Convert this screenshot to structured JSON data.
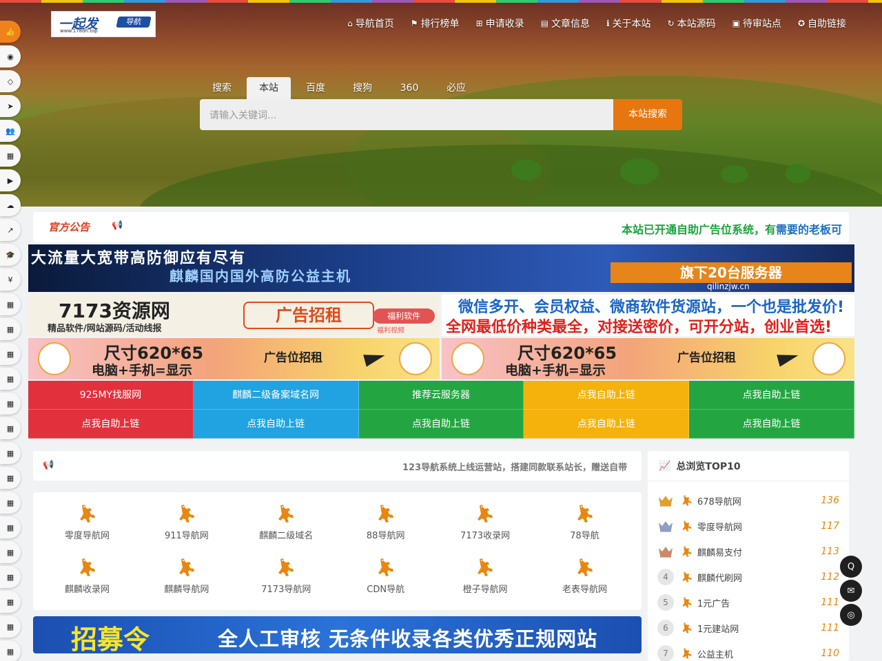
{
  "logo": {
    "brand": "一起发",
    "tag": "导航",
    "domain": "www.178dh.top"
  },
  "nav": [
    {
      "icon": "home-icon",
      "glyph": "⌂",
      "label": "导航首页"
    },
    {
      "icon": "flag-icon",
      "glyph": "⚑",
      "label": "排行榜单"
    },
    {
      "icon": "plus-square-icon",
      "glyph": "⊞",
      "label": "申请收录"
    },
    {
      "icon": "book-icon",
      "glyph": "▤",
      "label": "文章信息"
    },
    {
      "icon": "info-icon",
      "glyph": "ℹ",
      "label": "关于本站"
    },
    {
      "icon": "refresh-icon",
      "glyph": "↻",
      "label": "本站源码"
    },
    {
      "icon": "file-icon",
      "glyph": "▣",
      "label": "待审站点"
    },
    {
      "icon": "handshake-icon",
      "glyph": "✪",
      "label": "自助链接"
    }
  ],
  "search": {
    "tabs": [
      "搜索",
      "本站",
      "百度",
      "搜狗",
      "360",
      "必应"
    ],
    "active_tab": "本站",
    "placeholder": "请输入关键词...",
    "button": "本站搜索"
  },
  "sidebar_icons": [
    "thumbs-up-icon",
    "eye-icon",
    "diamond-icon",
    "paper-plane-icon",
    "users-icon",
    "cubes-icon",
    "youtube-icon",
    "cloud-icon",
    "line-chart-icon",
    "graduation-cap-icon",
    "yen-icon",
    "th-large-icon",
    "cubes-icon",
    "cubes-icon",
    "cubes-icon",
    "cubes-icon",
    "cubes-icon",
    "cubes-icon",
    "cubes-icon",
    "cubes-icon",
    "cubes-icon",
    "cubes-icon",
    "cubes-icon",
    "cubes-icon",
    "cubes-icon",
    "cubes-icon"
  ],
  "announcement": {
    "label": "官方公告",
    "message_a": "本站已开通自助广告位系统，有",
    "message_b": "需要的老板可"
  },
  "banners": {
    "qilin": {
      "line1": "大流量大宽带高防御应有尽有",
      "line2": "麒麟国内国外高防公益主机",
      "badge": "旗下20台服务器",
      "domain": "qilinzjw.cn"
    },
    "res7173": {
      "title": "7173资源网",
      "subtitle": "精品软件/网站源码/活动线报",
      "ad": "广告招租",
      "pill": "福利软件",
      "pill_sub": "福利视频"
    },
    "wechat": {
      "line1": "微信多开、会员权益、微商软件货源站，一个也是批发价!",
      "line2": "全网最低价种类最全，对接送密价，可开分站，创业首选!"
    },
    "size_ad": {
      "size": "尺寸620*65",
      "devices": "电脑+手机=显示",
      "ad": "广告位招租"
    }
  },
  "link_grid": [
    {
      "label": "925MY找服网",
      "color": "red"
    },
    {
      "label": "麒麟二级备案域名网",
      "color": "blue"
    },
    {
      "label": "推荐云服务器",
      "color": "green"
    },
    {
      "label": "点我自助上链",
      "color": "yellow"
    },
    {
      "label": "点我自助上链",
      "color": "green"
    },
    {
      "label": "点我自助上链",
      "color": "red"
    },
    {
      "label": "点我自助上链",
      "color": "blue"
    },
    {
      "label": "点我自助上链",
      "color": "green"
    },
    {
      "label": "点我自助上链",
      "color": "yellow"
    },
    {
      "label": "点我自助上链",
      "color": "green"
    }
  ],
  "notice2": "123导航系统上线运营站，搭建同款联系站长，赠送自带",
  "sites": [
    "零度导航网",
    "911导航网",
    "麒麟二级域名",
    "88导航网",
    "7173收录网",
    "78导航",
    "麒麟收录网",
    "麒麟导航网",
    "7173导航网",
    "CDN导航",
    "橙子导航网",
    "老表导航网"
  ],
  "recruit": {
    "big": "招募令",
    "rest": "全人工审核  无条件收录各类优秀正规网站"
  },
  "top10": {
    "title": "总浏览TOP10",
    "rows": [
      {
        "rank": "1",
        "name": "678导航网",
        "views": "136",
        "crown": "#e0a030"
      },
      {
        "rank": "2",
        "name": "零度导航网",
        "views": "117",
        "crown": "#8e9fc4"
      },
      {
        "rank": "3",
        "name": "麒麟易支付",
        "views": "113",
        "crown": "#c98a6a"
      },
      {
        "rank": "4",
        "name": "麒麟代刷网",
        "views": "112"
      },
      {
        "rank": "5",
        "name": "1元广告",
        "views": "111"
      },
      {
        "rank": "6",
        "name": "1元建站网",
        "views": "111"
      },
      {
        "rank": "7",
        "name": "公益主机",
        "views": "110"
      }
    ]
  },
  "float_buttons": [
    "qq-icon",
    "envelope-icon",
    "wechat-icon"
  ],
  "colors": {
    "accent": "#e8760f",
    "red": "#e2303d",
    "blue": "#20a3e0",
    "green": "#23a642",
    "yellow": "#f5b20c"
  }
}
